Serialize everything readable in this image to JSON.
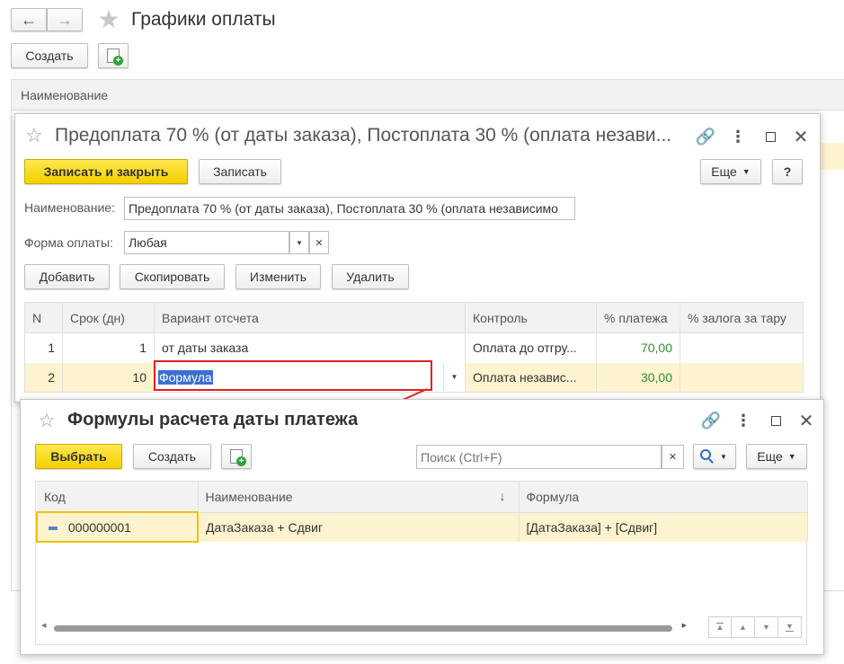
{
  "main": {
    "title": "Графики оплаты",
    "create_button": "Создать",
    "column_header": "Наименование"
  },
  "editor": {
    "title": "Предоплата 70 % (от даты заказа), Постоплата 30 % (оплата незави...",
    "save_close_button": "Записать и закрыть",
    "save_button": "Записать",
    "more_button": "Еще",
    "help_button": "?",
    "name_label": "Наименование:",
    "name_value": "Предоплата 70 % (от даты заказа), Постоплата 30 % (оплата независимо",
    "payment_form_label": "Форма оплаты:",
    "payment_form_value": "Любая",
    "add_button": "Добавить",
    "copy_button": "Скопировать",
    "edit_button": "Изменить",
    "delete_button": "Удалить",
    "columns": [
      "N",
      "Срок (дн)",
      "Вариант отсчета",
      "Контроль",
      "% платежа",
      "% залога за тару"
    ],
    "rows": [
      {
        "n": "1",
        "term": "1",
        "variant": "от даты заказа",
        "control": "Оплата до отгру...",
        "percent": "70,00",
        "deposit": ""
      },
      {
        "n": "2",
        "term": "10",
        "variant": "Формула",
        "control": "Оплата независ...",
        "percent": "30,00",
        "deposit": ""
      }
    ]
  },
  "chooser": {
    "title": "Формулы расчета даты платежа",
    "select_button": "Выбрать",
    "create_button": "Создать",
    "search_placeholder": "Поиск (Ctrl+F)",
    "more_button": "Еще",
    "columns": [
      "Код",
      "Наименование",
      "Формула"
    ],
    "sort_indicator": "↓",
    "rows": [
      {
        "code": "000000001",
        "name": "ДатаЗаказа + Сдвиг",
        "formula": "[ДатаЗаказа] + [Сдвиг]"
      }
    ]
  },
  "colors": {
    "accent_yellow": "#f4cf00",
    "selected_row": "#fdf3cf",
    "annotation_red": "#e02020",
    "selection_blue": "#3b6fd1"
  }
}
